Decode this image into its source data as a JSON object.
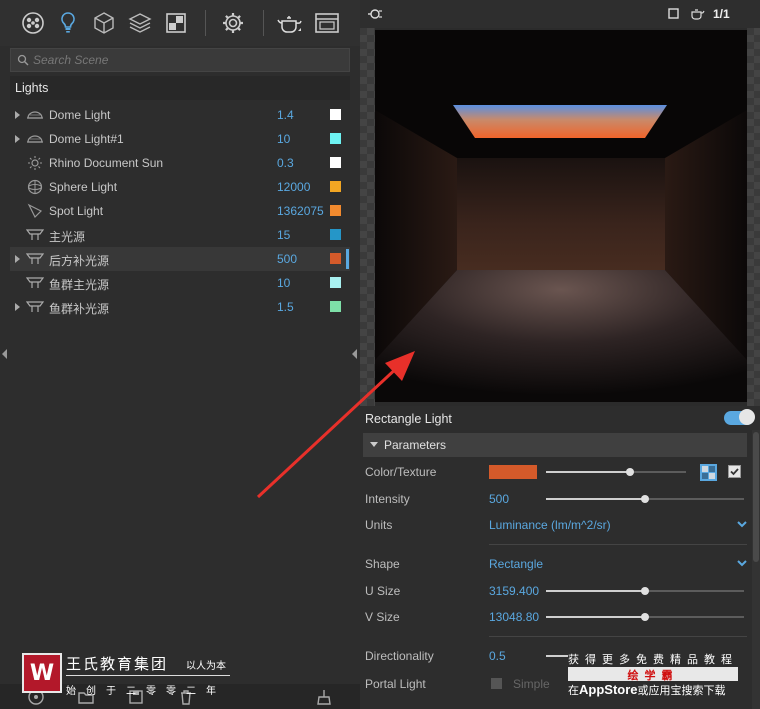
{
  "toolbar": {
    "icons": [
      "material-icon",
      "light-bulb-icon",
      "object-cube-icon",
      "layers-icon",
      "environment-icon",
      "settings-gear-icon",
      "teapot-render-icon",
      "window-icon"
    ]
  },
  "search": {
    "placeholder": "Search Scene",
    "value": ""
  },
  "lights_header": "Lights",
  "lights": [
    {
      "name": "Dome Light",
      "value": "1.4",
      "color": "#ffffff",
      "expandable": true,
      "icon": "dome-light-icon"
    },
    {
      "name": "Dome Light#1",
      "value": "10",
      "color": "#6ef2f2",
      "expandable": true,
      "icon": "dome-light-icon"
    },
    {
      "name": "Rhino Document Sun",
      "value": "0.3",
      "color": "#ffffff",
      "expandable": false,
      "icon": "sun-icon"
    },
    {
      "name": "Sphere Light",
      "value": "12000",
      "color": "#f2a623",
      "expandable": false,
      "icon": "sphere-light-icon"
    },
    {
      "name": "Spot Light",
      "value": "1362075",
      "color": "#f28a2e",
      "expandable": false,
      "icon": "spot-light-icon"
    },
    {
      "name": "主光源",
      "value": "15",
      "color": "#2596c8",
      "expandable": false,
      "icon": "rectangle-light-icon"
    },
    {
      "name": "后方补光源",
      "value": "500",
      "color": "#d45a2a",
      "expandable": true,
      "icon": "rectangle-light-icon",
      "selected": true
    },
    {
      "name": "鱼群主光源",
      "value": "10",
      "color": "#a8f0f0",
      "expandable": false,
      "icon": "rectangle-light-icon"
    },
    {
      "name": "鱼群补光源",
      "value": "1.5",
      "color": "#7ee0a8",
      "expandable": true,
      "icon": "rectangle-light-icon"
    }
  ],
  "watermark": {
    "logo_letter": "W",
    "title": "王氏教育集团",
    "motto": "以人为本",
    "subtitle": "始创于二零零二年",
    "r1": "获得更多免费精品教程",
    "r2": "绘学霸",
    "r3_pre": "在",
    "r3_bold": "AppStore",
    "r3_post": "或应用宝搜索下载"
  },
  "viewport_top": {
    "page": "1/1"
  },
  "props": {
    "title": "Rectangle Light",
    "enabled": true,
    "section": "Parameters",
    "color_texture": {
      "label": "Color/Texture",
      "color": "#d45a2a",
      "slider": 0.6,
      "checked": true
    },
    "intensity": {
      "label": "Intensity",
      "value": "500",
      "slider": 0.5
    },
    "units": {
      "label": "Units",
      "value": "Luminance (lm/m^2/sr)"
    },
    "shape": {
      "label": "Shape",
      "value": "Rectangle"
    },
    "u_size": {
      "label": "U Size",
      "value": "3159.400",
      "slider": 0.5
    },
    "v_size": {
      "label": "V Size",
      "value": "13048.80",
      "slider": 0.5
    },
    "directionality": {
      "label": "Directionality",
      "value": "0.5"
    },
    "portal_light": {
      "label": "Portal Light",
      "value": "Simple"
    }
  }
}
